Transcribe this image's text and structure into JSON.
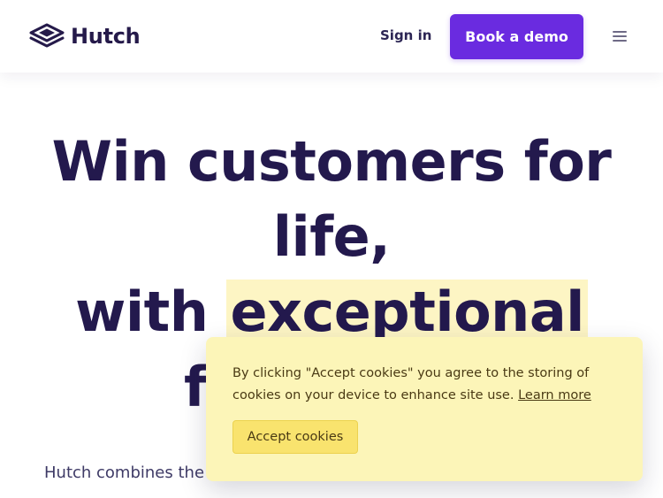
{
  "header": {
    "logo_text": "Hutch",
    "signin_label": "Sign in",
    "demo_label": "Book a demo",
    "menu_icon": "hamburger-menu-icon",
    "accent_color": "#6a2be0"
  },
  "hero": {
    "line1": "Win customers for",
    "line2": "life,",
    "line3_prefix": "with ",
    "line3_highlight": "exceptional",
    "line4_partial": "f",
    "highlight_color": "#fdf5c4"
  },
  "subtitle": {
    "text": "Hutch combines the"
  },
  "cookie_banner": {
    "message": "By clicking \"Accept cookies\" you agree to the storing of cookies on your device to enhance site use. ",
    "learn_more": "Learn more",
    "accept_label": "Accept cookies",
    "background_color": "#fcf5b8",
    "button_color": "#f9e36e"
  }
}
